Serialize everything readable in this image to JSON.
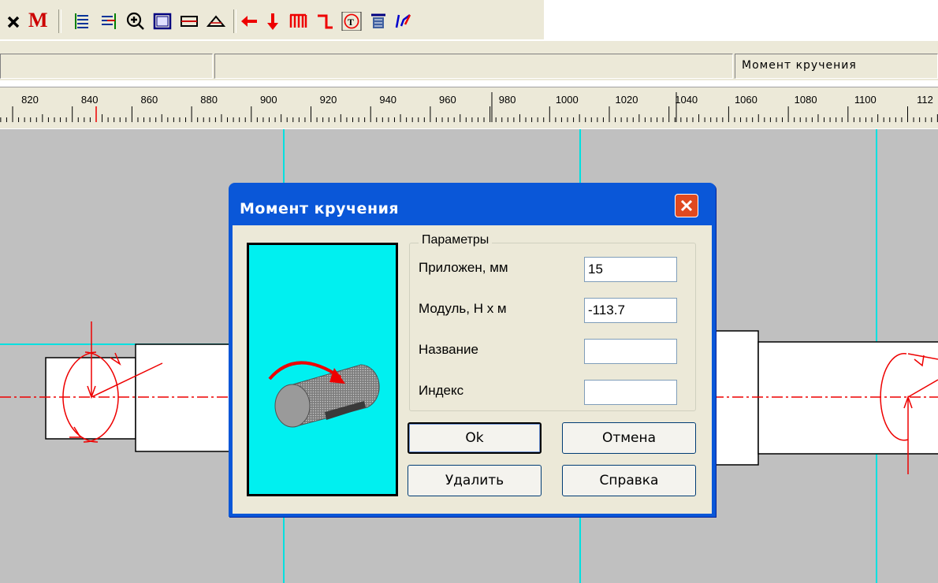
{
  "toolbar": {
    "items": [
      {
        "name": "close-icon"
      },
      {
        "name": "moment-m-icon",
        "text": "M"
      },
      {
        "name": "hatch-left-icon"
      },
      {
        "name": "hatch-right-icon"
      },
      {
        "name": "zoom-in-icon"
      },
      {
        "name": "frame-icon"
      },
      {
        "name": "section-icon"
      },
      {
        "name": "cone-icon"
      },
      {
        "name": "arrow-left-icon"
      },
      {
        "name": "arrow-down-icon"
      },
      {
        "name": "distributed-load-icon"
      },
      {
        "name": "step-icon"
      },
      {
        "name": "torque-icon"
      },
      {
        "name": "support-icon"
      },
      {
        "name": "calc-icon"
      }
    ]
  },
  "statusbar": {
    "panes": [
      "",
      "",
      "Момент кручения"
    ]
  },
  "ruler": {
    "labels": [
      "820",
      "840",
      "860",
      "880",
      "900",
      "920",
      "940",
      "960",
      "980",
      "1000",
      "1020",
      "1040",
      "1060",
      "1080",
      "1100",
      "112"
    ]
  },
  "dialog": {
    "title": "Момент кручения",
    "group_title": "Параметры",
    "fields": [
      {
        "label": "Приложен, мм",
        "value": "15"
      },
      {
        "label": "Модуль, Н х м",
        "value": "-113.7"
      },
      {
        "label": "Название",
        "value": ""
      },
      {
        "label": "Индекс",
        "value": ""
      }
    ],
    "buttons": {
      "ok": "Ok",
      "cancel": "Отмена",
      "delete": "Удалить",
      "help": "Справка"
    }
  },
  "colors": {
    "title_bar": "#0a57d8",
    "dialog_face": "#ece9d8",
    "preview_bg": "#00f0f0",
    "canvas_bg": "#c0c0c0",
    "guide_line": "#00e0e0",
    "force_red": "#ff0000"
  }
}
